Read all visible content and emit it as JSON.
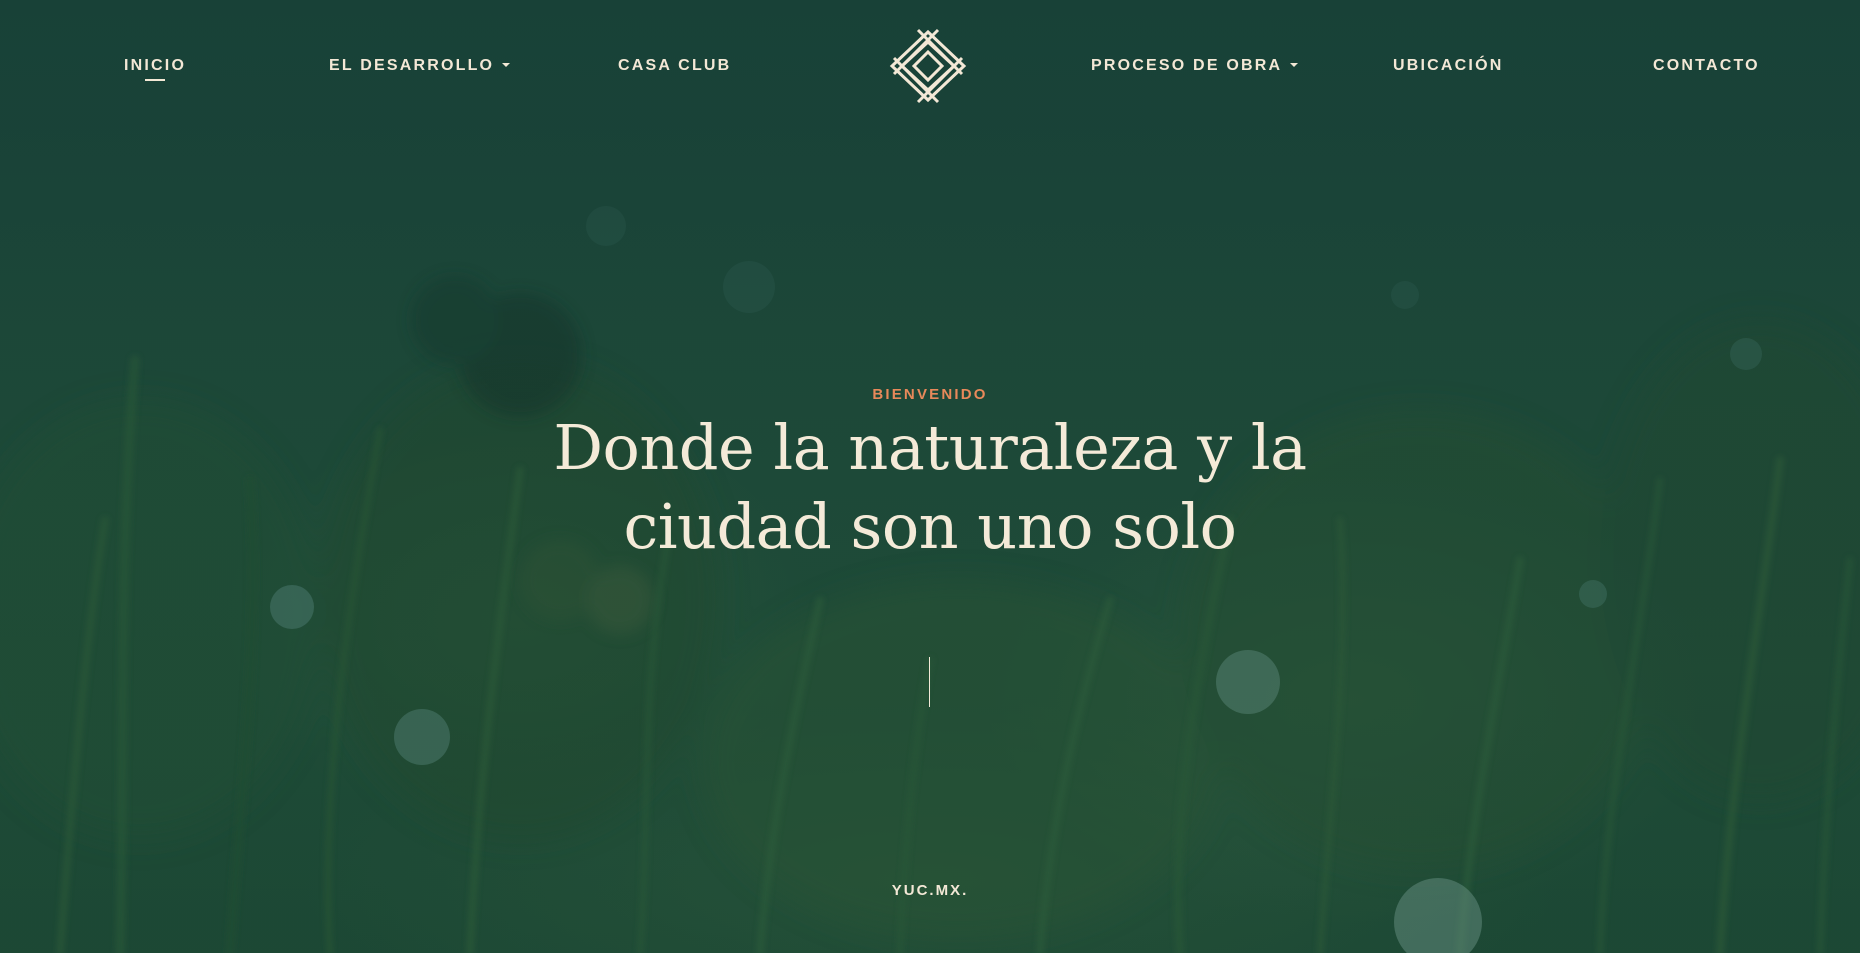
{
  "nav": {
    "items": [
      {
        "label": "INICIO",
        "active": true
      },
      {
        "label": "EL DESARROLLO",
        "dropdown": true
      },
      {
        "label": "CASA CLUB"
      },
      {
        "label": "PROCESO DE OBRA",
        "dropdown": true
      },
      {
        "label": "UBICACIÓN"
      },
      {
        "label": "CONTACTO"
      }
    ],
    "logo_icon": "diamond-lattice-logo-icon"
  },
  "hero": {
    "eyebrow": "BIENVENIDO",
    "headline_line1": "Donde la naturaleza y la",
    "headline_line2": "ciudad son uno solo",
    "scroll_indicator": "scroll-line"
  },
  "footer": {
    "brand": "YUC.MX."
  },
  "colors": {
    "background": "#1b4536",
    "text_cream": "#f4ead8",
    "accent_orange": "#e8895a"
  }
}
